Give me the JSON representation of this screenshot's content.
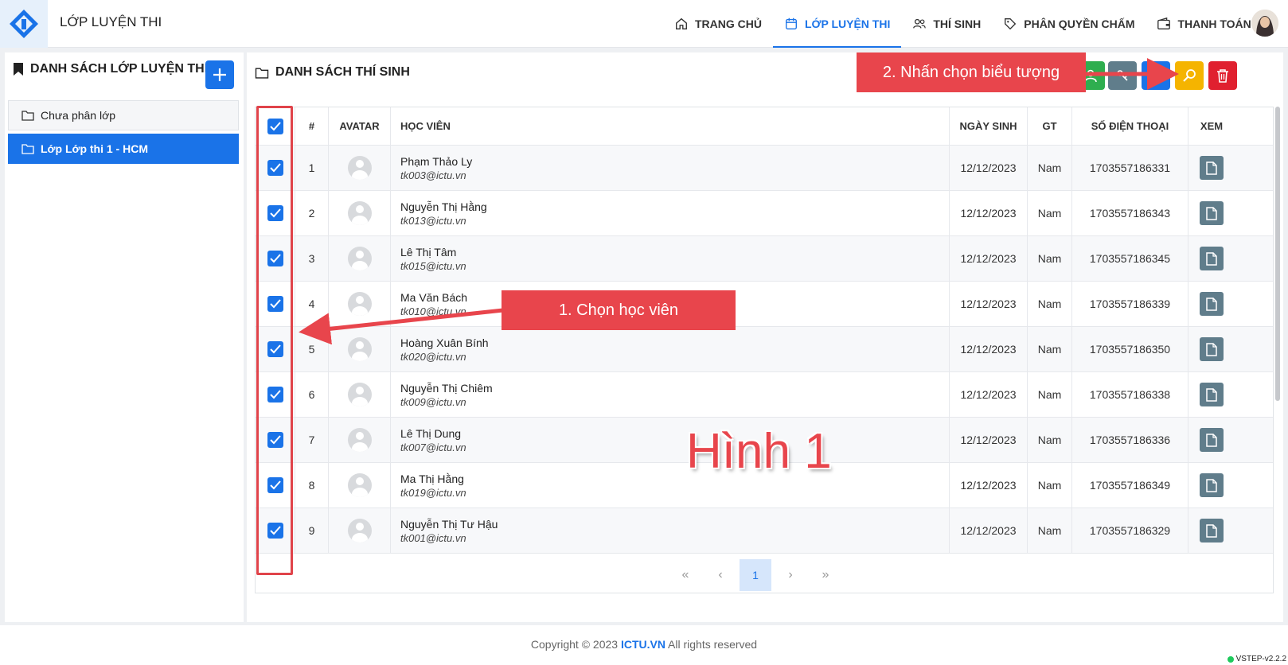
{
  "header": {
    "app_title": "LỚP LUYỆN THI",
    "nav": [
      {
        "label": "TRANG CHỦ",
        "icon": "home-icon",
        "active": false
      },
      {
        "label": "LỚP LUYỆN THI",
        "icon": "calendar-icon",
        "active": true
      },
      {
        "label": "THÍ SINH",
        "icon": "users-icon",
        "active": false
      },
      {
        "label": "PHÂN QUYỀN CHẤM",
        "icon": "tag-icon",
        "active": false
      },
      {
        "label": "THANH TOÁN",
        "icon": "wallet-icon",
        "active": false
      }
    ]
  },
  "left_panel": {
    "title": "DANH SÁCH LỚP LUYỆN THI",
    "classes": [
      {
        "label": "Chưa phân lớp",
        "active": false
      },
      {
        "label": "Lớp Lớp thi 1 - HCM",
        "active": true
      }
    ]
  },
  "right_panel": {
    "title": "DANH SÁCH THÍ SINH",
    "columns": {
      "num": "#",
      "avatar": "AVATAR",
      "student": "HỌC VIÊN",
      "dob": "NGÀY SINH",
      "gender": "GT",
      "phone": "SỐ ĐIỆN THOẠI",
      "view": "XEM"
    },
    "rows": [
      {
        "num": "1",
        "name": "Phạm Thảo Ly",
        "email": "tk003@ictu.vn",
        "dob": "12/12/2023",
        "gender": "Nam",
        "phone": "1703557186331"
      },
      {
        "num": "2",
        "name": "Nguyễn Thị Hằng",
        "email": "tk013@ictu.vn",
        "dob": "12/12/2023",
        "gender": "Nam",
        "phone": "1703557186343"
      },
      {
        "num": "3",
        "name": "Lê Thị Tâm",
        "email": "tk015@ictu.vn",
        "dob": "12/12/2023",
        "gender": "Nam",
        "phone": "1703557186345"
      },
      {
        "num": "4",
        "name": "Ma Văn Bách",
        "email": "tk010@ictu.vn",
        "dob": "12/12/2023",
        "gender": "Nam",
        "phone": "1703557186339"
      },
      {
        "num": "5",
        "name": "Hoàng Xuân Bính",
        "email": "tk020@ictu.vn",
        "dob": "12/12/2023",
        "gender": "Nam",
        "phone": "1703557186350"
      },
      {
        "num": "6",
        "name": "Nguyễn Thị Chiêm",
        "email": "tk009@ictu.vn",
        "dob": "12/12/2023",
        "gender": "Nam",
        "phone": "1703557186338"
      },
      {
        "num": "7",
        "name": "Lê Thị Dung",
        "email": "tk007@ictu.vn",
        "dob": "12/12/2023",
        "gender": "Nam",
        "phone": "1703557186336"
      },
      {
        "num": "8",
        "name": "Ma Thị Hằng",
        "email": "tk019@ictu.vn",
        "dob": "12/12/2023",
        "gender": "Nam",
        "phone": "1703557186349"
      },
      {
        "num": "9",
        "name": "Nguyễn Thị Tư Hậu",
        "email": "tk001@ictu.vn",
        "dob": "12/12/2023",
        "gender": "Nam",
        "phone": "1703557186329"
      }
    ],
    "pagination": {
      "first": "«",
      "prev": "‹",
      "current": "1",
      "next": "›",
      "last": "»"
    }
  },
  "annotations": {
    "step1": "1. Chọn học viên",
    "step2": "2. Nhấn chọn biểu tượng",
    "figure": "Hình 1"
  },
  "footer": {
    "copyright_prefix": "Copyright © 2023 ",
    "brand": "ICTU.VN",
    "copyright_suffix": " All rights reserved",
    "version": "VSTEP-v2.2.2"
  },
  "colors": {
    "primary": "#1a73e8",
    "success": "#2eae4f",
    "warning": "#f5b400",
    "danger": "#e0202f",
    "slate": "#607d8b",
    "annotation": "#e8454c"
  }
}
